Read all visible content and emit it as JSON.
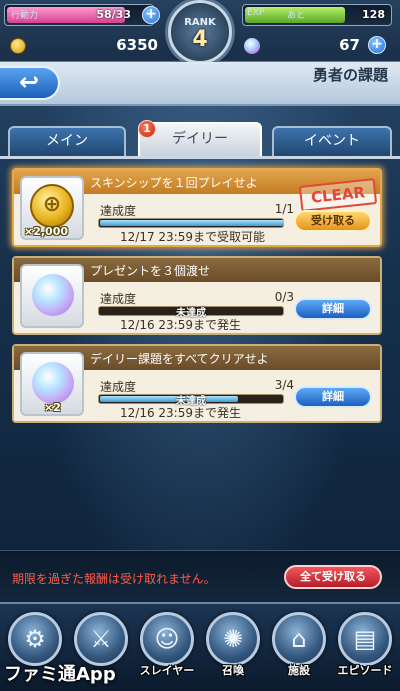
{
  "status": {
    "stamina_label": "行動力",
    "stamina_value": "58/33",
    "exp_label": "EXP",
    "exp_next_label": "あと",
    "exp_value": "128",
    "rank_label": "RANK",
    "rank_value": "4",
    "gold": "6350",
    "gems": "67"
  },
  "header": {
    "back_icon": "↩",
    "title": "勇者の課題"
  },
  "tabs": [
    {
      "label": "メイン"
    },
    {
      "label": "デイリー",
      "badge": "1",
      "active": true
    },
    {
      "label": "イベント"
    }
  ],
  "tasks": [
    {
      "title": "スキンシップを１回プレイせよ",
      "reward_count": "×2,000",
      "progress_label": "達成度",
      "progress_value": "1/1",
      "progress_fraction": 1.0,
      "status_text": "",
      "deadline": "12/17  23:59まで受取可能",
      "button": "受け取る",
      "stamp": "CLEAR"
    },
    {
      "title": "プレゼントを３個渡せ",
      "reward_count": "",
      "progress_label": "達成度",
      "progress_value": "0/3",
      "progress_fraction": 0.0,
      "status_text": "未達成",
      "deadline": "12/16  23:59まで発生",
      "button": "詳細"
    },
    {
      "title": "デイリー課題をすべてクリアせよ",
      "reward_count": "×2",
      "progress_label": "達成度",
      "progress_value": "3/4",
      "progress_fraction": 0.75,
      "status_text": "未達成",
      "deadline": "12/16  23:59まで発生",
      "button": "詳細"
    }
  ],
  "notice": {
    "text": "期限を過ぎた報酬は受け取れません。",
    "claim_all": "全て受け取る"
  },
  "nav": [
    {
      "label": "",
      "icon": "⚙"
    },
    {
      "label": "",
      "icon": "⚔"
    },
    {
      "label": "スレイヤー",
      "icon": "☺"
    },
    {
      "label": "召喚",
      "icon": "✺"
    },
    {
      "label": "施設",
      "icon": "⌂"
    },
    {
      "label": "エピソード",
      "icon": "▤"
    }
  ],
  "watermark": "ファミ通App",
  "colors": {
    "accent": "#1d5fc0",
    "claim": "#e6931e",
    "warning": "#ff5b4a"
  }
}
